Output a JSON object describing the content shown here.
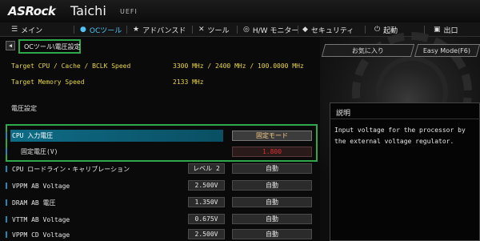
{
  "header": {
    "logo": "ASRock",
    "product": "Taichi",
    "uefi": "UEFI"
  },
  "nav": {
    "items": [
      {
        "label": "メイン",
        "icon": "menu-icon",
        "glyph": "☰",
        "active": false
      },
      {
        "label": "OCツール",
        "icon": "droplet-icon",
        "glyph": "●",
        "active": true
      },
      {
        "label": "アドバンスド",
        "icon": "star-icon",
        "glyph": "★",
        "active": false
      },
      {
        "label": "ツール",
        "icon": "wrench-icon",
        "glyph": "✕",
        "active": false
      },
      {
        "label": "H/W モニター",
        "icon": "monitor-icon",
        "glyph": "◎",
        "active": false
      },
      {
        "label": "セキュリティ",
        "icon": "shield-icon",
        "glyph": "◆",
        "active": false
      },
      {
        "label": "起動",
        "icon": "power-icon",
        "glyph": "⏻",
        "active": false
      },
      {
        "label": "出口",
        "icon": "exit-icon",
        "glyph": "▣",
        "active": false
      }
    ]
  },
  "breadcrumb": "OCツール\\電圧設定",
  "favorites_label": "お気に入り",
  "easy_mode_label": "Easy Mode(F6)",
  "info": [
    {
      "label": "Target CPU / Cache / BCLK Speed",
      "value": "3300 MHz / 2400 MHz / 100.0000 MHz"
    },
    {
      "label": "Target Memory Speed",
      "value": "2133 MHz"
    }
  ],
  "section_title": "電圧設定",
  "rows": [
    {
      "label": "CPU 入力電圧",
      "small": "",
      "value": "固定モード"
    },
    {
      "label": "固定電圧(V)",
      "small": "",
      "value": "1.800"
    },
    {
      "label": "CPU ロードライン・キャリブレーション",
      "small": "レベル 2",
      "value": "自動"
    },
    {
      "label": "VPPM AB  Voltage",
      "small": "2.500V",
      "value": "自動"
    },
    {
      "label": "DRAM AB 電圧",
      "small": "1.350V",
      "value": "自動"
    },
    {
      "label": "VTTM AB  Voltage",
      "small": "0.675V",
      "value": "自動"
    },
    {
      "label": "VPPM CD  Voltage",
      "small": "2.500V",
      "value": "自動"
    }
  ],
  "description": {
    "title": "説明",
    "text": "Input voltage for the processor by the external voltage regulator."
  },
  "colors": {
    "accent": "#4fc3f7",
    "highlight_frame": "#2ea84a",
    "info_text": "#e8d64a",
    "selected_bar": "#0e6c86",
    "warning_value": "#e03030"
  }
}
